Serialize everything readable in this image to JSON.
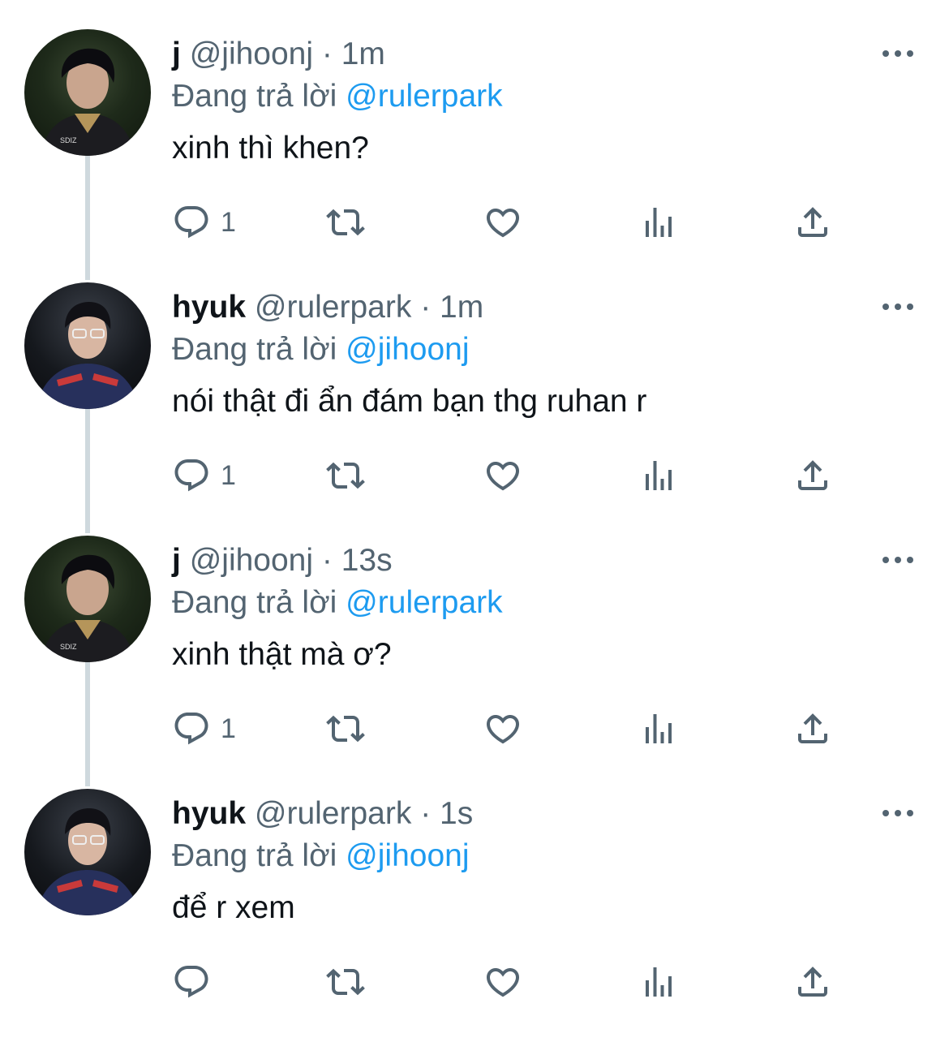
{
  "thread": [
    {
      "display_name": "j",
      "handle": "@jihoonj",
      "time": "· 1m",
      "reply_prefix": "Đang trả lời",
      "reply_to": "@rulerpark",
      "text": "xinh thì khen?",
      "reply_count": "1",
      "avatar": "j"
    },
    {
      "display_name": "hyuk",
      "handle": "@rulerpark",
      "time": "· 1m",
      "reply_prefix": "Đang trả lời",
      "reply_to": "@jihoonj",
      "text": "nói thật đi ẩn đám bạn thg ruhan r",
      "reply_count": "1",
      "avatar": "h"
    },
    {
      "display_name": "j",
      "handle": "@jihoonj",
      "time": "· 13s",
      "reply_prefix": "Đang trả lời",
      "reply_to": "@rulerpark",
      "text": "xinh thật mà ơ?",
      "reply_count": "1",
      "avatar": "j"
    },
    {
      "display_name": "hyuk",
      "handle": "@rulerpark",
      "time": "· 1s",
      "reply_prefix": "Đang trả lời",
      "reply_to": "@jihoonj",
      "text": "để r xem",
      "reply_count": "",
      "avatar": "h"
    }
  ],
  "icons": {
    "reply": "reply-icon",
    "retweet": "retweet-icon",
    "like": "heart-icon",
    "views": "views-icon",
    "share": "share-icon",
    "more": "more-icon"
  },
  "colors": {
    "accent": "#1d9bf0",
    "muted": "#536471",
    "text": "#0f1419",
    "thread_line": "#cfd9de"
  }
}
